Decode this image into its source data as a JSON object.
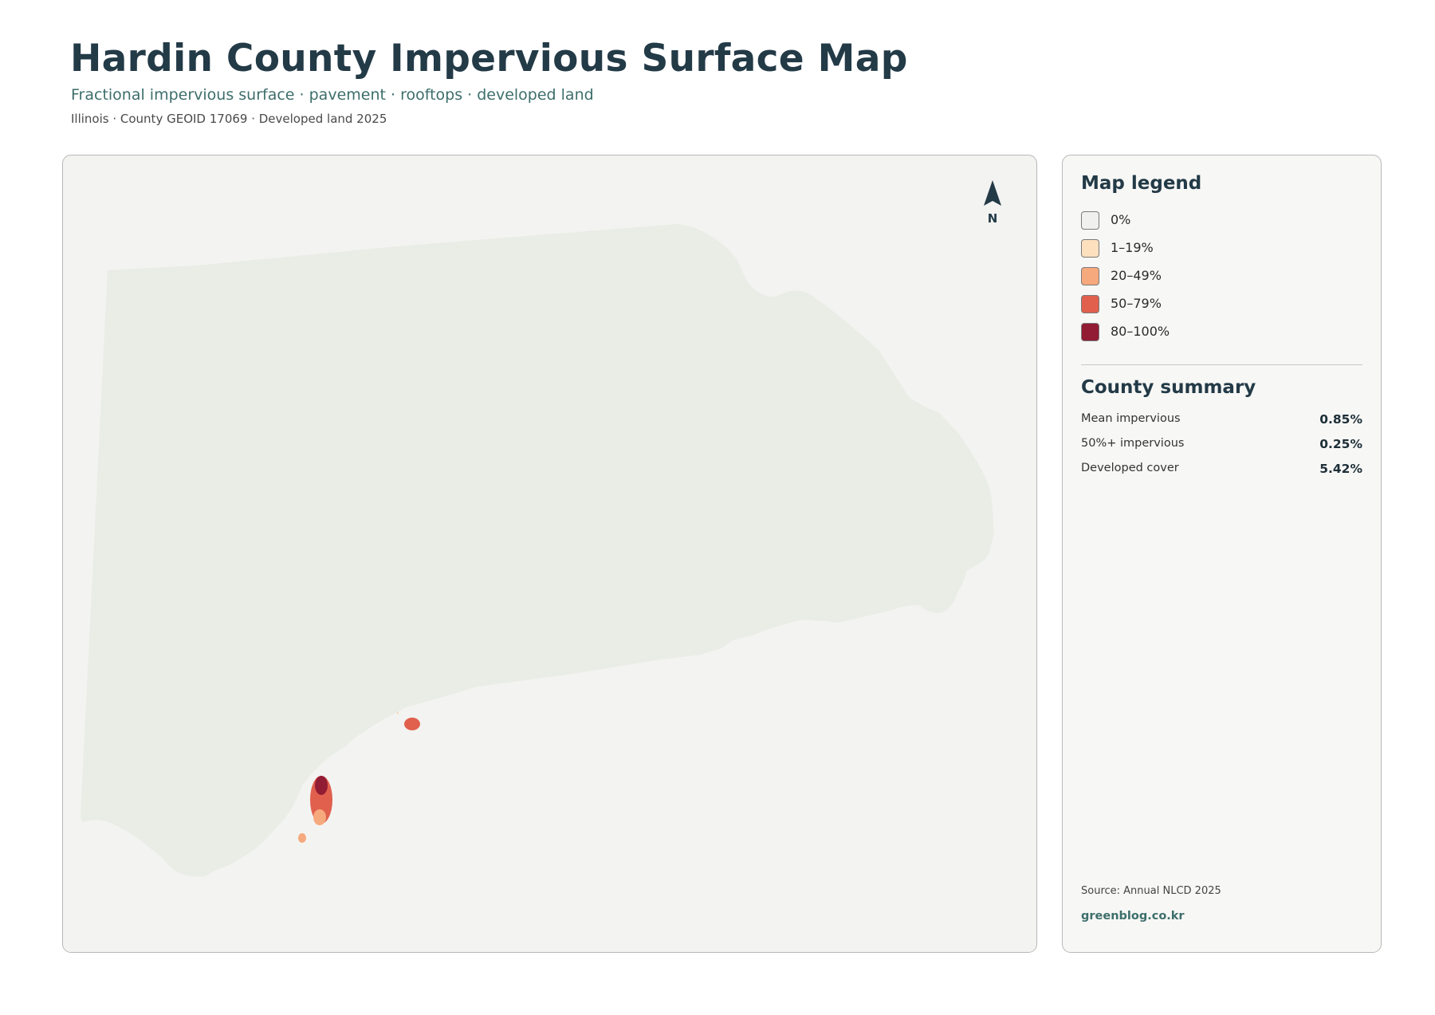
{
  "header": {
    "title": "Hardin County Impervious Surface Map",
    "subtitle": "Fractional impervious surface · pavement · rooftops · developed land",
    "meta": "Illinois · County GEOID 17069 · Developed land 2025"
  },
  "map": {
    "north_label": "N",
    "boundary_color": "#223640",
    "land_color": "#e9ede6"
  },
  "legend": {
    "heading": "Map legend",
    "items": [
      {
        "label": "0%",
        "color": "#f0f0ee"
      },
      {
        "label": "1–19%",
        "color": "#fde1bf"
      },
      {
        "label": "20–49%",
        "color": "#f6a97d"
      },
      {
        "label": "50–79%",
        "color": "#e0604d"
      },
      {
        "label": "80–100%",
        "color": "#921c34"
      }
    ]
  },
  "summary": {
    "heading": "County summary",
    "rows": [
      {
        "label": "Mean impervious",
        "value": "0.85%"
      },
      {
        "label": "50%+ impervious",
        "value": "0.25%"
      },
      {
        "label": "Developed cover",
        "value": "5.42%"
      }
    ]
  },
  "footer": {
    "source": "Source: Annual NLCD 2025",
    "credit": "greenblog.co.kr"
  }
}
